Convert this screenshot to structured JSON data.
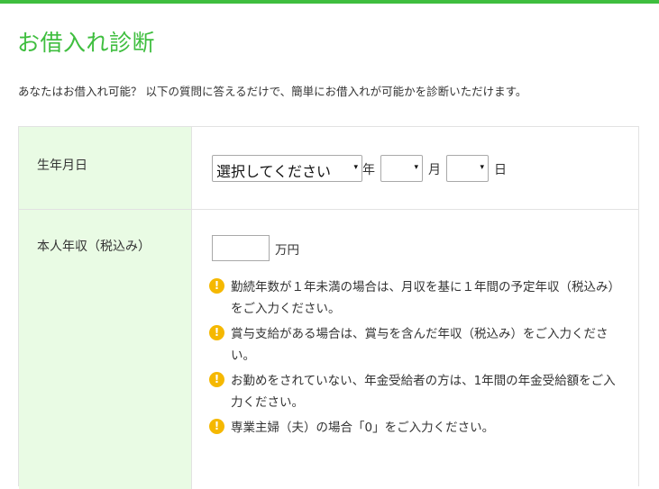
{
  "page": {
    "title": "お借入れ診断",
    "intro": "あなたはお借入れ可能？ 以下の質問に答えるだけで、簡単にお借入れが可能かを診断いただけます。"
  },
  "form": {
    "birthdate": {
      "label": "生年月日",
      "year_select": "選択してください",
      "year_unit": "年",
      "month_select": "",
      "month_unit": "月",
      "day_select": "",
      "day_unit": "日"
    },
    "income": {
      "label": "本人年収（税込み）",
      "value": "",
      "unit": "万円",
      "notes": [
        "勤続年数が１年未満の場合は、月収を基に１年間の予定年収（税込み）をご入力ください。",
        "賞与支給がある場合は、賞与を含んだ年収（税込み）をご入力ください。",
        "お勤めをされていない、年金受給者の方は、1年間の年金受給額をご入力ください。",
        "専業主婦（夫）の場合「0」をご入力ください。"
      ]
    }
  },
  "icons": {
    "caret": "▾",
    "warning": "!"
  },
  "colors": {
    "accent": "#3fbe3f",
    "label_bg": "#e9fbe4",
    "warning": "#f5b800"
  }
}
